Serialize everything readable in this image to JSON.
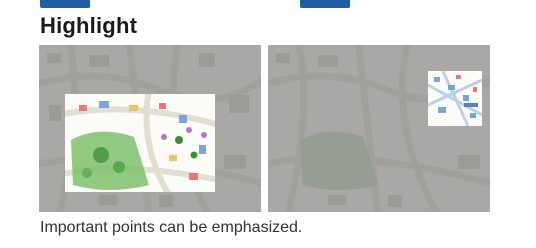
{
  "heading": "Highlight",
  "caption": "Important points can be emphasized.",
  "colors": {
    "accent_bar": "#1f5fa8",
    "dim_overlay": "#8c8c8c",
    "text": "#1a1a1a",
    "caption_text": "#333333"
  },
  "panels": [
    {
      "name": "highlight-area-example",
      "mode": "dimmed-background-with-highlighted-area"
    },
    {
      "name": "highlight-zoom-example",
      "mode": "dimmed-background-with-highlighted-inset"
    }
  ]
}
